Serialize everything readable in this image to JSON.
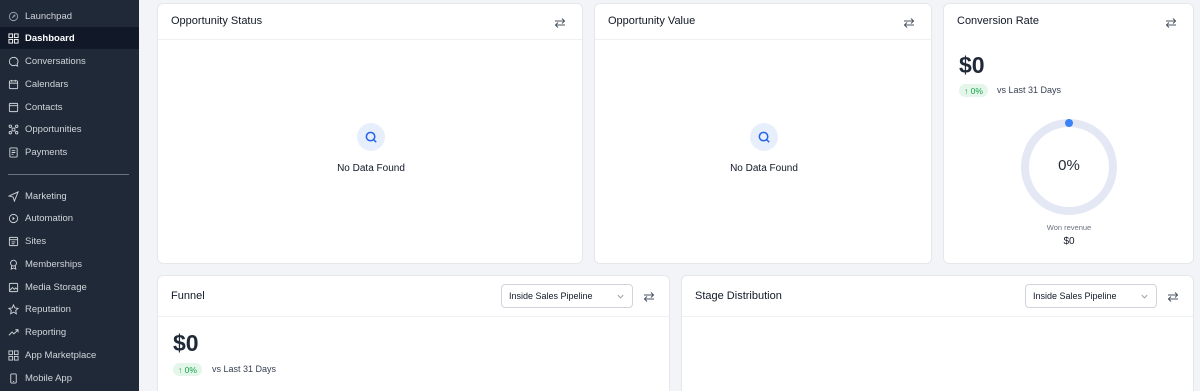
{
  "sidebar": {
    "items": [
      {
        "label": "Launchpad",
        "icon": "rocket-icon"
      },
      {
        "label": "Dashboard",
        "icon": "dashboard-grid-icon",
        "active": true
      },
      {
        "label": "Conversations",
        "icon": "chat-bubble-icon"
      },
      {
        "label": "Calendars",
        "icon": "calendar-icon"
      },
      {
        "label": "Contacts",
        "icon": "contacts-icon"
      },
      {
        "label": "Opportunities",
        "icon": "opportunities-icon"
      },
      {
        "label": "Payments",
        "icon": "payments-icon"
      },
      {
        "label": "Marketing",
        "icon": "send-icon"
      },
      {
        "label": "Automation",
        "icon": "automation-icon"
      },
      {
        "label": "Sites",
        "icon": "sites-icon"
      },
      {
        "label": "Memberships",
        "icon": "membership-icon"
      },
      {
        "label": "Media Storage",
        "icon": "image-icon"
      },
      {
        "label": "Reputation",
        "icon": "star-icon"
      },
      {
        "label": "Reporting",
        "icon": "trend-icon"
      },
      {
        "label": "App Marketplace",
        "icon": "apps-grid-icon"
      },
      {
        "label": "Mobile App",
        "icon": "mobile-icon"
      }
    ]
  },
  "cards": {
    "opportunity_status": {
      "title": "Opportunity Status",
      "empty_text": "No Data Found"
    },
    "opportunity_value": {
      "title": "Opportunity Value",
      "empty_text": "No Data Found"
    },
    "conversion_rate": {
      "title": "Conversion Rate",
      "value": "$0",
      "change": "↑ 0%",
      "compare_text": "vs Last 31 Days",
      "donut_percent_label": "0%",
      "donut_fraction": 0,
      "won_label": "Won revenue",
      "won_value": "$0"
    },
    "funnel": {
      "title": "Funnel",
      "pipeline": "Inside Sales Pipeline",
      "value": "$0",
      "change": "↑ 0%",
      "compare_text": "vs Last 31 Days"
    },
    "stage_distribution": {
      "title": "Stage Distribution",
      "pipeline": "Inside Sales Pipeline"
    }
  },
  "colors": {
    "accent": "#3b82f6",
    "sidebar_bg": "#1f2937",
    "positive": "#16a34a",
    "donut_track": "#e3e8f4"
  }
}
